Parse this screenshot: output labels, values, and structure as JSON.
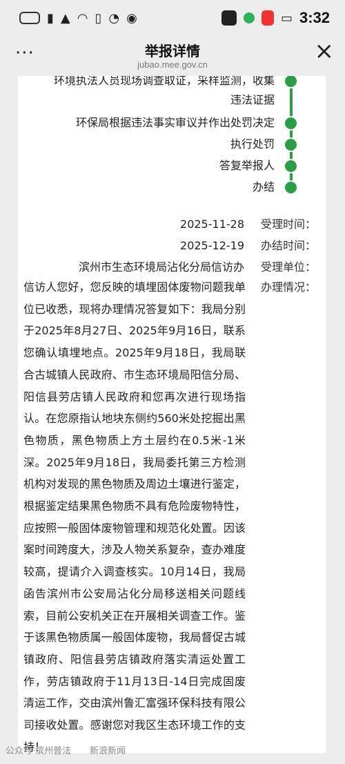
{
  "status_bar": {
    "time": "3:32",
    "icons": [
      "app-icon",
      "notification-icon",
      "vpn-icon",
      "signal-icon",
      "wifi-icon",
      "battery-icon"
    ]
  },
  "nav": {
    "title": "举报详情",
    "url": "jubao.mee.gov.cn",
    "more_icon": "···",
    "close_icon": "×"
  },
  "timeline": [
    {
      "text": "环境执法人员现场调查取证，采样监测，收集"
    },
    {
      "text": "违法证据"
    },
    {
      "text": "环保局根据违法事实审议并作出处罚决定"
    },
    {
      "text": "执行处罚"
    },
    {
      "text": "答复举报人"
    },
    {
      "text": "办结"
    }
  ],
  "info": {
    "accept_time_label": "受理时间：",
    "accept_time": "2025-11-28",
    "finish_time_label": "办结时间：",
    "finish_time": "2025-12-19",
    "unit_label": "受理单位：",
    "unit": "滨州市生态环境局沾化分局信访办",
    "detail_label": "办理情况：",
    "detail": "信访人您好，您反映的填埋固体废物问题我单位已收悉，现将办理情况答复如下：我局分别于2025年8月27日、2025年9月16日，联系您确认填埋地点。2025年9月18日，我局联合古城镇人民政府、市生态环境局阳信分局、阳信县劳店镇人民政府和您再次进行现场指认。在您原指认地块东侧约560米处挖掘出黑色物质，黑色物质上方土层约在0.5米-1米深。2025年9月18日，我局委托第三方检测机构对发现的黑色物质及周边土壤进行鉴定，根据鉴定结果黑色物质不具有危险废物特性，应按照一般固体废物管理和规范化处置。因该案时间跨度大，涉及人物关系复杂，查办难度较高，提请介入调查核实。10月14日，我局函告滨州市公安局沾化分局移送相关问题线索，目前公安机关正在开展相关调查工作。鉴于该黑色物质属一般固体废物，我局督促古城镇政府、阳信县劳店镇政府落实清运处置工作，劳店镇政府于11月13日-14日完成固废清运工作，交由滨州鲁汇富强环保科技有限公司接收处置。感谢您对我区生态环境工作的支持！"
  },
  "watermark": {
    "left": "公众号·滨州普法",
    "right": "新浪新闻"
  }
}
